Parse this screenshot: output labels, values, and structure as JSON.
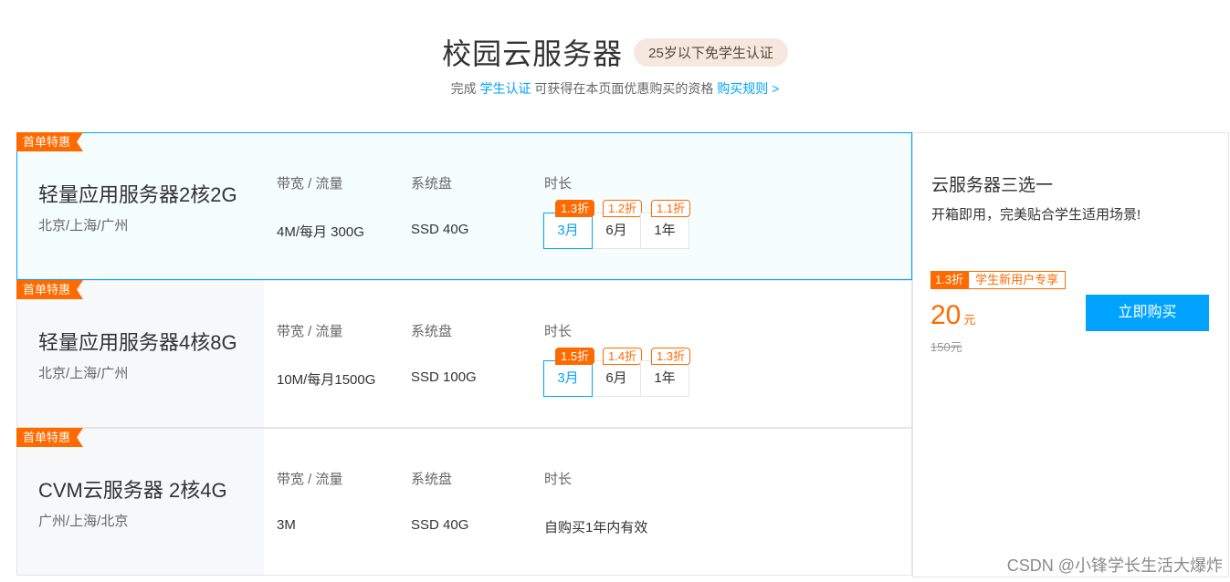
{
  "header": {
    "title": "校园云服务器",
    "badge": "25岁以下免学生认证",
    "sub_prefix": "完成",
    "sub_link": "学生认证",
    "sub_middle": "可获得在本页面优惠购买的资格",
    "rules_link": "购买规则 >"
  },
  "columns": {
    "bandwidth": "带宽 / 流量",
    "disk": "系统盘",
    "duration": "时长"
  },
  "products": [
    {
      "ribbon": "首单特惠",
      "name": "轻量应用服务器2核2G",
      "region": "北京/上海/广州",
      "bandwidth": "4M/每月 300G",
      "disk": "SSD 40G",
      "periods": [
        {
          "label": "3月",
          "discount": "1.3折"
        },
        {
          "label": "6月",
          "discount": "1.2折"
        },
        {
          "label": "1年",
          "discount": "1.1折"
        }
      ]
    },
    {
      "ribbon": "首单特惠",
      "name": "轻量应用服务器4核8G",
      "region": "北京/上海/广州",
      "bandwidth": "10M/每月1500G",
      "disk": "SSD 100G",
      "periods": [
        {
          "label": "3月",
          "discount": "1.5折"
        },
        {
          "label": "6月",
          "discount": "1.4折"
        },
        {
          "label": "1年",
          "discount": "1.3折"
        }
      ]
    },
    {
      "ribbon": "首单特惠",
      "name": "CVM云服务器 2核4G",
      "region": "广州/上海/北京",
      "bandwidth": "3M",
      "disk": "SSD 40G",
      "duration_text": "自购买1年内有效"
    }
  ],
  "panel": {
    "title": "云服务器三选一",
    "desc": "开箱即用，完美贴合学生适用场景!",
    "tag_discount": "1.3折",
    "tag_label": "学生新用户专享",
    "price": "20",
    "price_unit": "元",
    "original_price": "150元",
    "buy_label": "立即购买"
  },
  "watermark": "CSDN @小锋学长生活大爆炸",
  "colors": {
    "accent": "#00a4ff",
    "orange": "#ff6a00"
  }
}
